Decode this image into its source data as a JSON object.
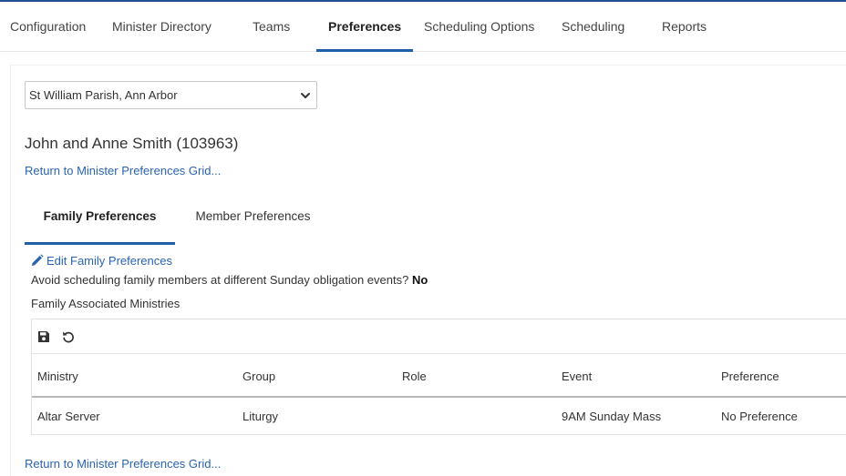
{
  "nav": {
    "items": [
      {
        "label": "Configuration"
      },
      {
        "label": "Minister Directory"
      },
      {
        "label": "Teams"
      },
      {
        "label": "Preferences"
      },
      {
        "label": "Scheduling Options"
      },
      {
        "label": "Scheduling"
      },
      {
        "label": "Reports"
      }
    ],
    "active": "Preferences"
  },
  "parish_select": {
    "value": "St William Parish, Ann Arbor"
  },
  "family": {
    "title": "John and Anne Smith (103963)"
  },
  "links": {
    "return_top": "Return to Minister Preferences Grid...",
    "return_bottom": "Return to Minister Preferences Grid..."
  },
  "tabs": [
    {
      "label": "Family Preferences"
    },
    {
      "label": "Member Preferences"
    }
  ],
  "family_prefs": {
    "edit_label": "Edit Family Preferences",
    "question": "Avoid scheduling family members at different Sunday obligation events?",
    "answer": "No",
    "section_label": "Family Associated Ministries"
  },
  "grid": {
    "toolbar": {
      "save_icon": "save-icon",
      "undo_icon": "undo-icon"
    },
    "columns": [
      "Ministry",
      "Group",
      "Role",
      "Event",
      "Preference"
    ],
    "rows": [
      [
        "Altar Server",
        "Liturgy",
        "",
        "9AM Sunday Mass",
        "No Preference"
      ]
    ]
  },
  "colors": {
    "accent": "#1f5fa8",
    "link": "#2a64b0",
    "topbar": "#1f4f8c"
  }
}
